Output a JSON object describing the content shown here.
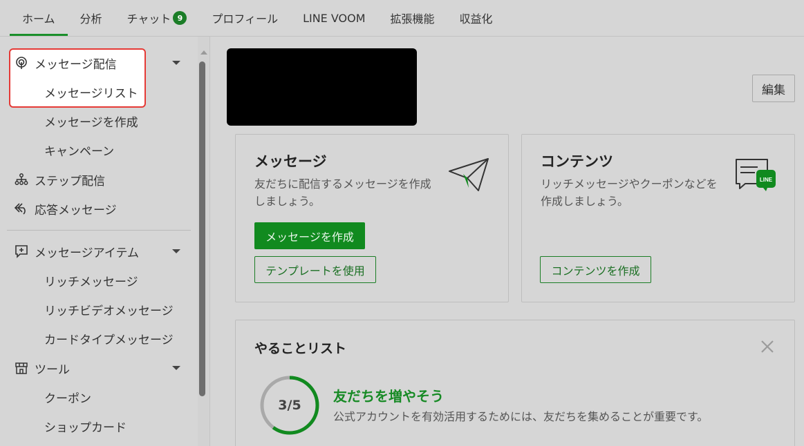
{
  "nav": {
    "tabs": [
      {
        "label": "ホーム"
      },
      {
        "label": "分析"
      },
      {
        "label": "チャット",
        "badge": "9"
      },
      {
        "label": "プロフィール"
      },
      {
        "label": "LINE VOOM"
      },
      {
        "label": "拡張機能"
      },
      {
        "label": "収益化"
      }
    ],
    "active_tab": "ホーム"
  },
  "sidebar": {
    "broadcast": {
      "label": "メッセージ配信",
      "icon": "broadcast-icon"
    },
    "broadcast_subs": [
      "メッセージリスト",
      "メッセージを作成",
      "キャンペーン"
    ],
    "step": {
      "label": "ステップ配信",
      "icon": "step-tree-icon"
    },
    "auto_reply": {
      "label": "応答メッセージ",
      "icon": "reply-icon"
    },
    "items": {
      "label": "メッセージアイテム",
      "icon": "message-plus-icon"
    },
    "items_subs": [
      "リッチメッセージ",
      "リッチビデオメッセージ",
      "カードタイプメッセージ"
    ],
    "tools": {
      "label": "ツール",
      "icon": "shop-icon"
    },
    "tools_subs": [
      "クーポン",
      "ショップカード"
    ]
  },
  "header": {
    "edit_label": "編集"
  },
  "cards": {
    "message": {
      "title": "メッセージ",
      "desc1": "友だちに配信するメッセージを作成",
      "desc2": "しましょう。",
      "primary_btn": "メッセージを作成",
      "secondary_btn": "テンプレートを使用",
      "icon": "paper-plane-icon"
    },
    "contents": {
      "title": "コンテンツ",
      "desc1": "リッチメッセージやクーポンなどを",
      "desc2": "作成しましょう。",
      "btn": "コンテンツを作成",
      "icon": "line-chat-icon",
      "icon_text": "LINE"
    }
  },
  "todo": {
    "title": "やることリスト",
    "progress_label": "3/5",
    "progress_fraction": 0.6,
    "heading": "友だちを増やそう",
    "desc": "公式アカウントを有効活用するためには、友だちを集めることが重要です。"
  },
  "colors": {
    "accent": "#1a8f2a",
    "highlight_border": "#e53935"
  }
}
